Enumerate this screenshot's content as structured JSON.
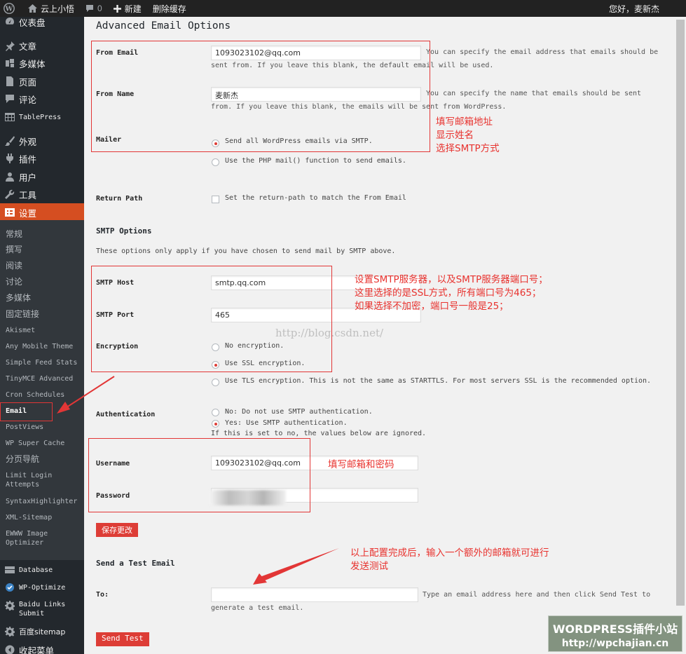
{
  "admin_bar": {
    "site_name": "云上小悟",
    "comments_count": "0",
    "new_label": "新建",
    "clear_cache": "删除缓存",
    "greeting": "您好，麦新杰"
  },
  "sidebar": {
    "dashboard": "仪表盘",
    "posts": "文章",
    "media": "多媒体",
    "pages": "页面",
    "comments": "评论",
    "tablepress": "TablePress",
    "appearance": "外观",
    "plugins": "插件",
    "users": "用户",
    "tools": "工具",
    "settings": "设置",
    "submenu": [
      "常规",
      "撰写",
      "阅读",
      "讨论",
      "多媒体",
      "固定链接",
      "Akismet",
      "Any Mobile Theme",
      "Simple Feed Stats",
      "TinyMCE Advanced",
      "Cron Schedules",
      "Email",
      "PostViews",
      "WP Super Cache",
      "分页导航",
      "Limit Login Attempts",
      "SyntaxHighlighter",
      "XML-Sitemap",
      "EWWW Image Optimizer"
    ],
    "database": "Database",
    "wp_optimize": "WP-Optimize",
    "baidu_links": "Baidu Links Submit",
    "baidu_sitemap": "百度sitemap",
    "collapse": "收起菜单"
  },
  "page": {
    "title": "Advanced Email Options",
    "from_email": {
      "label": "From Email",
      "value": "1093023102@qq.com",
      "description": "You can specify the email address that emails should be sent from. If you leave this blank, the default email will be used."
    },
    "from_name": {
      "label": "From Name",
      "value": "麦新杰",
      "description": "You can specify the name that emails should be sent from. If you leave this blank, the emails will be sent from WordPress."
    },
    "mailer": {
      "label": "Mailer",
      "options": [
        "Send all WordPress emails via SMTP.",
        "Use the PHP mail() function to send emails."
      ],
      "selected": 0
    },
    "return_path": {
      "label": "Return Path",
      "checkbox_label": "Set the return-path to match the From Email",
      "checked": false
    },
    "smtp_section": {
      "title": "SMTP Options",
      "intro": "These options only apply if you have chosen to send mail by SMTP above."
    },
    "smtp_host": {
      "label": "SMTP Host",
      "value": "smtp.qq.com"
    },
    "smtp_port": {
      "label": "SMTP Port",
      "value": "465"
    },
    "encryption": {
      "label": "Encryption",
      "options": [
        "No encryption.",
        "Use SSL encryption.",
        "Use TLS encryption. This is not the same as STARTTLS. For most servers SSL is the recommended option."
      ],
      "selected": 1
    },
    "authentication": {
      "label": "Authentication",
      "options": [
        "No: Do not use SMTP authentication.",
        "Yes: Use SMTP authentication."
      ],
      "selected": 1,
      "note": "If this is set to no, the values below are ignored."
    },
    "username": {
      "label": "Username",
      "value": "1093023102@qq.com"
    },
    "password": {
      "label": "Password"
    },
    "save_button": "保存更改",
    "test_section": {
      "title": "Send a Test Email"
    },
    "to": {
      "label": "To:",
      "value": "",
      "description": "Type an email address here and then click Send Test to generate a test email."
    },
    "send_test_button": "Send Test"
  },
  "annotations": {
    "a1": [
      "填写邮箱地址",
      "显示姓名",
      "选择SMTP方式"
    ],
    "a2": [
      "设置SMTP服务器，以及SMTP服务器端口号；",
      "这里选择的是SSL方式，所有端口号为465；",
      "如果选择不加密，端口号一般是25；"
    ],
    "a3": "填写邮箱和密码",
    "a4": [
      "以上配置完成后，输入一个额外的邮箱就可进行",
      "发送测试"
    ]
  },
  "watermarks": {
    "csdn": "http://blog.csdn.net/",
    "logo_line1": "WORDPRESS插件小站",
    "logo_line2": "http://wpchajian.cn"
  },
  "colors": {
    "accent": "#dd3d36",
    "sidebar_bg": "#23282d",
    "annotation": "#e8332f"
  }
}
